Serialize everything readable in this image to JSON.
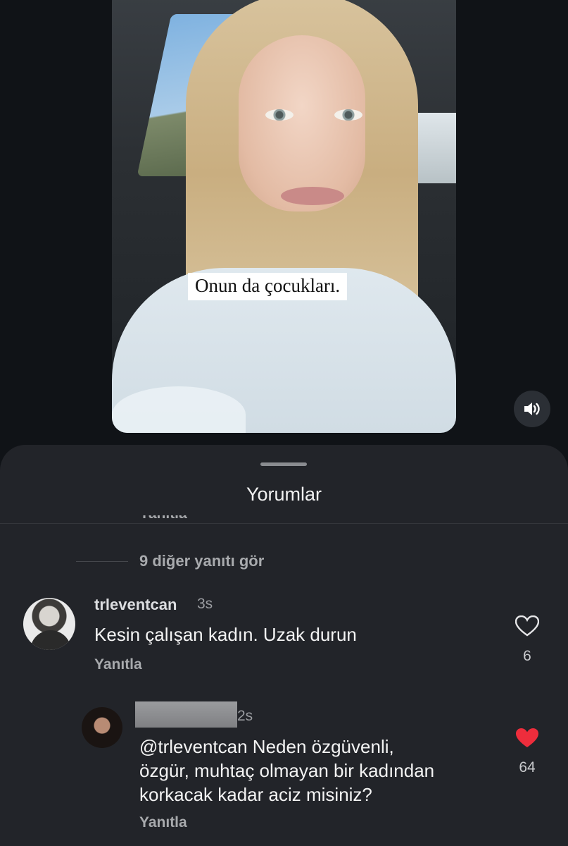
{
  "video": {
    "caption": "Onun da çocukları."
  },
  "comments_sheet": {
    "title": "Yorumlar",
    "partial_reply_label": "Yanıtla",
    "more_replies": "9 diğer yanıtı gör"
  },
  "comments": [
    {
      "username": "trleventcan",
      "time": "3s",
      "text": "Kesin çalışan kadın. Uzak durun",
      "reply_label": "Yanıtla",
      "likes": "6",
      "liked": false
    },
    {
      "username": "",
      "time": "2s",
      "text_line1": "@trleventcan Neden özgüvenli,",
      "text_line2": "özgür,  muhtaç olmayan bir kadından",
      "text_line3": "korkacak kadar aciz misiniz?",
      "reply_label": "Yanıtla",
      "likes": "64",
      "liked": true
    }
  ],
  "colors": {
    "background": "#101317",
    "sheet": "#222429",
    "like_active": "#ee2d3c"
  },
  "icons": [
    "volume-icon",
    "heart-outline-icon",
    "heart-filled-icon"
  ]
}
